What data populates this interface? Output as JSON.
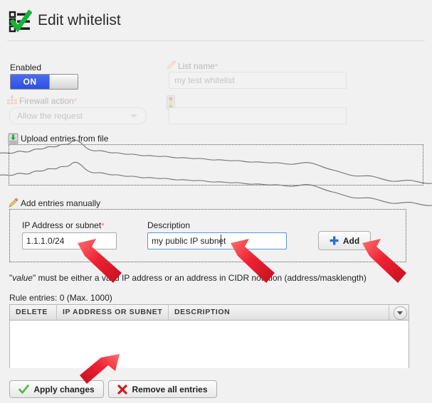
{
  "header": {
    "title": "Edit whitelist",
    "icon": "checklist-check-icon"
  },
  "form": {
    "enabled": {
      "label": "Enabled",
      "state": "ON",
      "on_color": "#3552e0"
    },
    "list_name": {
      "label": "List name",
      "required_marker": "*",
      "value": "my test whitelist",
      "icon": "pencil-icon",
      "disabled": "true"
    },
    "firewall_action": {
      "label": "Firewall action",
      "required_marker": "*",
      "value": "Allow the request",
      "icon": "firewall-brick-icon",
      "disabled": "true"
    },
    "action_value": {
      "value": "",
      "icon": "traffic-light-icon",
      "disabled": "true"
    }
  },
  "upload_section": {
    "label": "Upload entries from file",
    "icon": "upload-icon"
  },
  "manual_section": {
    "label": "Add entries manually",
    "icon": "pencil-icon",
    "ip_field": {
      "label": "IP Address or subnet",
      "required_marker": "*",
      "value": "1.1.1.0/24"
    },
    "description_field": {
      "label": "Description",
      "value": "my public IP subnet",
      "focused": "true"
    },
    "add_button": {
      "label": "Add",
      "icon": "plus-icon",
      "icon_color": "#2a6fd4"
    }
  },
  "hint": {
    "quoted": "\"value\"",
    "italic_word": "value",
    "text_after": " must be either a valid IP address or an address in CIDR notation (address/masklength)"
  },
  "entries": {
    "count_text": "Rule entries: 0 (Max. 1000)",
    "columns": [
      "DELETE",
      "IP ADDRESS OR SUBNET",
      "DESCRIPTION"
    ],
    "rows": []
  },
  "footer": {
    "apply_button": {
      "label": "Apply changes",
      "icon": "green-check-icon"
    },
    "remove_button": {
      "label": "Remove all entries",
      "icon": "red-x-icon"
    }
  },
  "annotations": {
    "arrow_color": "#e8253a",
    "arrows": [
      "arrow-ip-field",
      "arrow-description-field",
      "arrow-add-button",
      "arrow-apply-changes"
    ]
  }
}
